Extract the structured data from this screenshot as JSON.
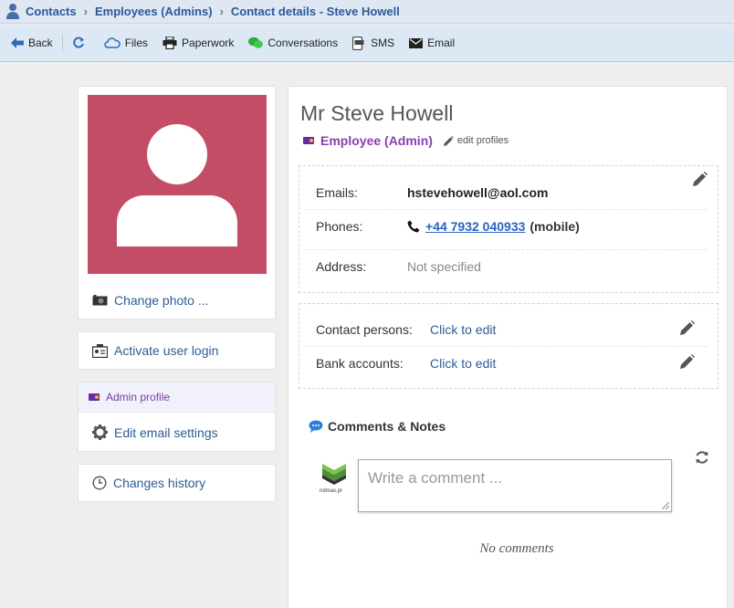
{
  "breadcrumb": [
    "Contacts",
    "Employees (Admins)",
    "Contact details - Steve Howell"
  ],
  "breadcrumb_sep": "›",
  "toolbar": {
    "back": "Back",
    "files": "Files",
    "paperwork": "Paperwork",
    "conversations": "Conversations",
    "sms": "SMS",
    "email": "Email"
  },
  "left": {
    "change_photo": "Change photo ...",
    "activate_login": "Activate user login",
    "admin_profile": "Admin profile",
    "edit_email_settings": "Edit email settings",
    "changes_history": "Changes history"
  },
  "contact": {
    "name": "Mr Steve Howell",
    "role": "Employee (Admin)",
    "edit_profiles": "edit profiles",
    "emails_label": "Emails:",
    "email": "hstevehowell@aol.com",
    "phones_label": "Phones:",
    "phone": "+44 7932 040933",
    "phone_type": "(mobile)",
    "address_label": "Address:",
    "address": "Not specified",
    "contact_persons_label": "Contact persons:",
    "contact_persons": "Click to edit",
    "bank_accounts_label": "Bank accounts:",
    "bank_accounts": "Click to edit"
  },
  "comments": {
    "title": "Comments & Notes",
    "placeholder": "Write a comment ...",
    "avatar_label": "ndmax.pr",
    "empty": "No comments"
  },
  "colors": {
    "photo_bg": "#c34d64",
    "link": "#2c5d92",
    "role": "#8a3db0",
    "toolbar_bg": "#dde8f5"
  }
}
